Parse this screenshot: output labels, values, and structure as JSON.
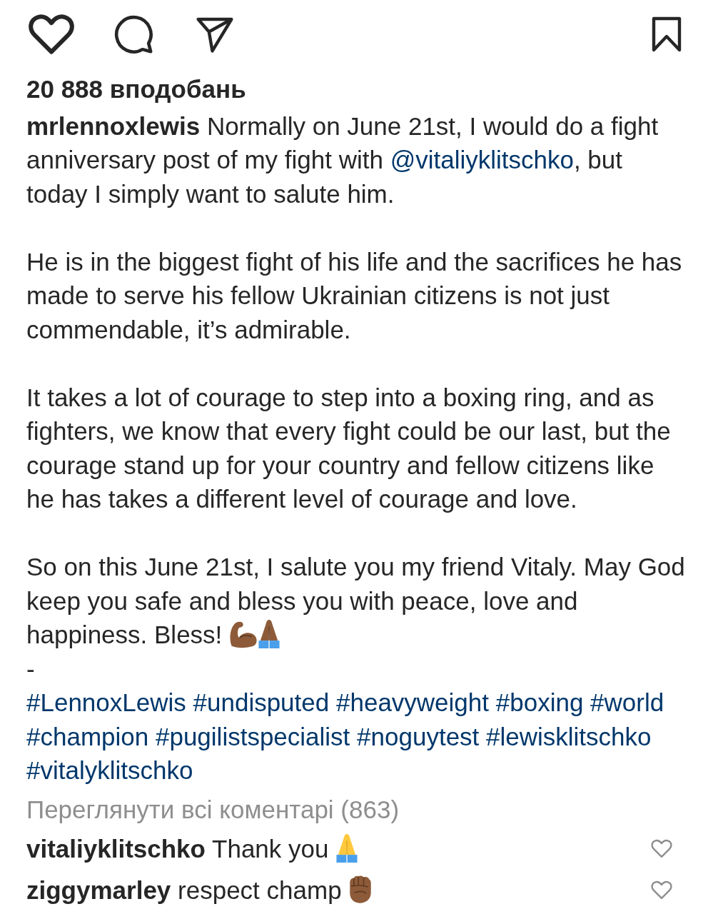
{
  "actions": {
    "liked": false,
    "saved": false
  },
  "likes": "20 888 вподобань",
  "caption": {
    "username": "mrlennoxlewis",
    "paragraphs": [
      {
        "lines": [
          [
            {
              "kind": "text",
              "text": "Normally on June 21st, I would do a fight anniversary post of my fight with "
            },
            {
              "kind": "mention",
              "text": "@vitaliyklitschko"
            },
            {
              "kind": "text",
              "text": ", but today I simply want to salute him."
            }
          ]
        ]
      },
      {
        "lines": [
          [
            {
              "kind": "text",
              "text": "He is in the biggest fight of his life and the sacrifices he has made to serve his fellow Ukrainian citizens is not just commendable, it’s admirable."
            }
          ]
        ]
      },
      {
        "lines": [
          [
            {
              "kind": "text",
              "text": "It takes a lot of courage to step into a boxing ring, and as fighters, we know that every fight could be our last, but the courage stand up for your country and fellow citizens like he has takes a different level of courage and love."
            }
          ]
        ]
      },
      {
        "lines": [
          [
            {
              "kind": "text",
              "text": "So on this June 21st, I salute you my friend Vitaly. May God keep you safe and bless you with peace, love and happiness. Bless! "
            },
            {
              "kind": "biceps",
              "dark_skin": true
            },
            {
              "kind": "prayer",
              "dark_skin": true
            }
          ],
          [
            {
              "kind": "text",
              "text": "-"
            }
          ],
          [
            {
              "kind": "hashtag",
              "text": "#LennoxLewis"
            },
            {
              "kind": "hashtag",
              "text": "#undisputed"
            },
            {
              "kind": "hashtag",
              "text": "#heavyweight"
            },
            {
              "kind": "hashtag",
              "text": "#boxing"
            },
            {
              "kind": "hashtag",
              "text": "#world"
            },
            {
              "kind": "hashtag",
              "text": "#champion"
            },
            {
              "kind": "hashtag",
              "text": "#pugilistspecialist"
            },
            {
              "kind": "hashtag",
              "text": "#noguytest"
            },
            {
              "kind": "hashtag",
              "text": "#lewisklitschko"
            },
            {
              "kind": "hashtag",
              "text": "#vitalyklitschko"
            }
          ]
        ]
      }
    ]
  },
  "view_all_comments": "Переглянути всі коментарі (863)",
  "comments": [
    {
      "username": "vitaliyklitschko",
      "segments": [
        {
          "kind": "text",
          "text": "Thank you"
        },
        {
          "kind": "prayer",
          "dark_skin": false
        }
      ],
      "liked": false
    },
    {
      "username": "ziggymarley",
      "segments": [
        {
          "kind": "text",
          "text": "respect champ"
        },
        {
          "kind": "fist",
          "dark_skin": true
        }
      ],
      "liked": false
    }
  ]
}
